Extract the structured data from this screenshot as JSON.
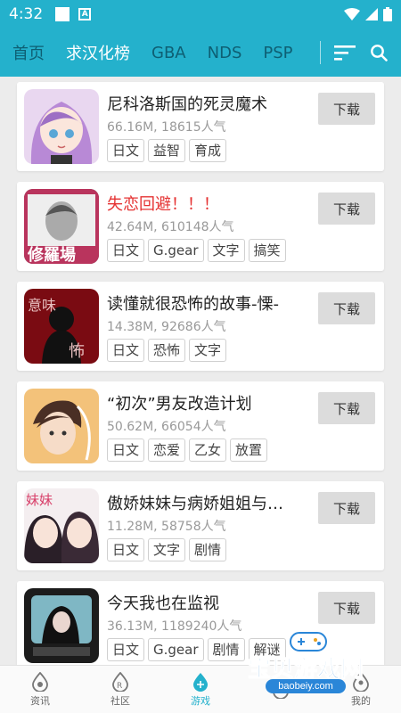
{
  "status_bar": {
    "time": "4:32"
  },
  "nav": {
    "tabs": [
      {
        "label": "首页",
        "active": false
      },
      {
        "label": "求汉化榜",
        "active": true
      },
      {
        "label": "GBA",
        "active": false
      },
      {
        "label": "NDS",
        "active": false
      },
      {
        "label": "PSP",
        "active": false
      }
    ]
  },
  "games": [
    {
      "title": "尼科洛斯国的死灵魔术",
      "title_color": "normal",
      "meta": "66.16M, 18615人气",
      "tags": [
        "日文",
        "益智",
        "育成"
      ],
      "button": "下载"
    },
    {
      "title": "失恋回避！！！",
      "title_color": "red",
      "meta": "42.64M, 610148人气",
      "tags": [
        "日文",
        "G.gear",
        "文字",
        "搞笑"
      ],
      "button": "下载"
    },
    {
      "title": "读懂就很恐怖的故事-慄-",
      "title_color": "normal",
      "meta": "14.38M, 92686人气",
      "tags": [
        "日文",
        "恐怖",
        "文字"
      ],
      "button": "下载"
    },
    {
      "title": "“初次”男友改造计划",
      "title_color": "normal",
      "meta": "50.62M, 66054人气",
      "tags": [
        "日文",
        "恋爱",
        "乙女",
        "放置"
      ],
      "button": "下载"
    },
    {
      "title": "傲娇妹妹与病娇姐姐与…",
      "title_color": "normal",
      "meta": "11.28M, 58758人气",
      "tags": [
        "日文",
        "文字",
        "剧情"
      ],
      "button": "下载"
    },
    {
      "title": "今天我也在监视",
      "title_color": "normal",
      "meta": "36.13M, 1189240人气",
      "tags": [
        "日文",
        "G.gear",
        "剧情",
        "解谜"
      ],
      "button": "下载"
    }
  ],
  "tabbar": {
    "items": [
      {
        "label": "资讯",
        "icon": "news-icon",
        "active": false
      },
      {
        "label": "社区",
        "icon": "community-icon",
        "active": false
      },
      {
        "label": "游戏",
        "icon": "game-drop-icon",
        "active": true
      },
      {
        "label": "",
        "icon": "gift-icon",
        "active": false
      },
      {
        "label": "我的",
        "icon": "profile-icon",
        "active": false
      }
    ]
  },
  "watermark": {
    "text": "宝贝游戏网",
    "url": "baobeiy.com"
  },
  "colors": {
    "accent": "#24b1cc",
    "inactive_tab": "#0e5f73",
    "red_title": "#e53333"
  }
}
